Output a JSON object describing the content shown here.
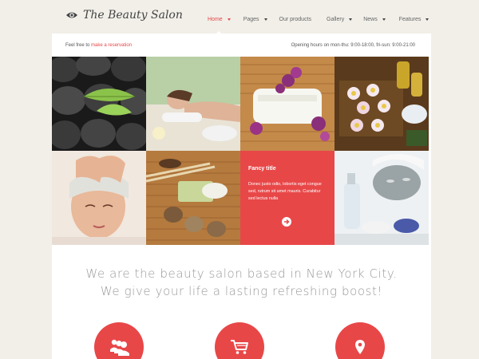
{
  "site": {
    "logo_text": "The Beauty Salon",
    "logo_icon": "eye-icon"
  },
  "nav": {
    "items": [
      {
        "label": "Home",
        "active": true,
        "has_caret": true
      },
      {
        "label": "Pages",
        "active": false,
        "has_caret": true
      },
      {
        "label": "Our products",
        "active": false,
        "has_caret": false
      },
      {
        "label": "Gallery",
        "active": false,
        "has_caret": true
      },
      {
        "label": "News",
        "active": false,
        "has_caret": true
      },
      {
        "label": "Features",
        "active": false,
        "has_caret": true
      }
    ]
  },
  "info_bar": {
    "prefix": "Feel free to",
    "link": "make a reservation",
    "hours": "Opening hours on mon-thu: 9:00-18:00, fri-sun: 9:00-21:00"
  },
  "fancy": {
    "title": "Fancy title",
    "text": "Donec justo odio, lobortis eget congue sed, rutrum sit amet mauris. Curabitur sed lectus nulla",
    "button_icon": "arrow-right-icon"
  },
  "tagline": {
    "line1": "We are the beauty salon based in New York City.",
    "line2": "We give your life a lasting refreshing boost!"
  },
  "features": [
    {
      "icon": "users-icon"
    },
    {
      "icon": "cart-icon"
    },
    {
      "icon": "location-pin-icon"
    }
  ],
  "colors": {
    "accent": "#e84748",
    "background": "#f1efe8",
    "panel": "#ffffff"
  }
}
